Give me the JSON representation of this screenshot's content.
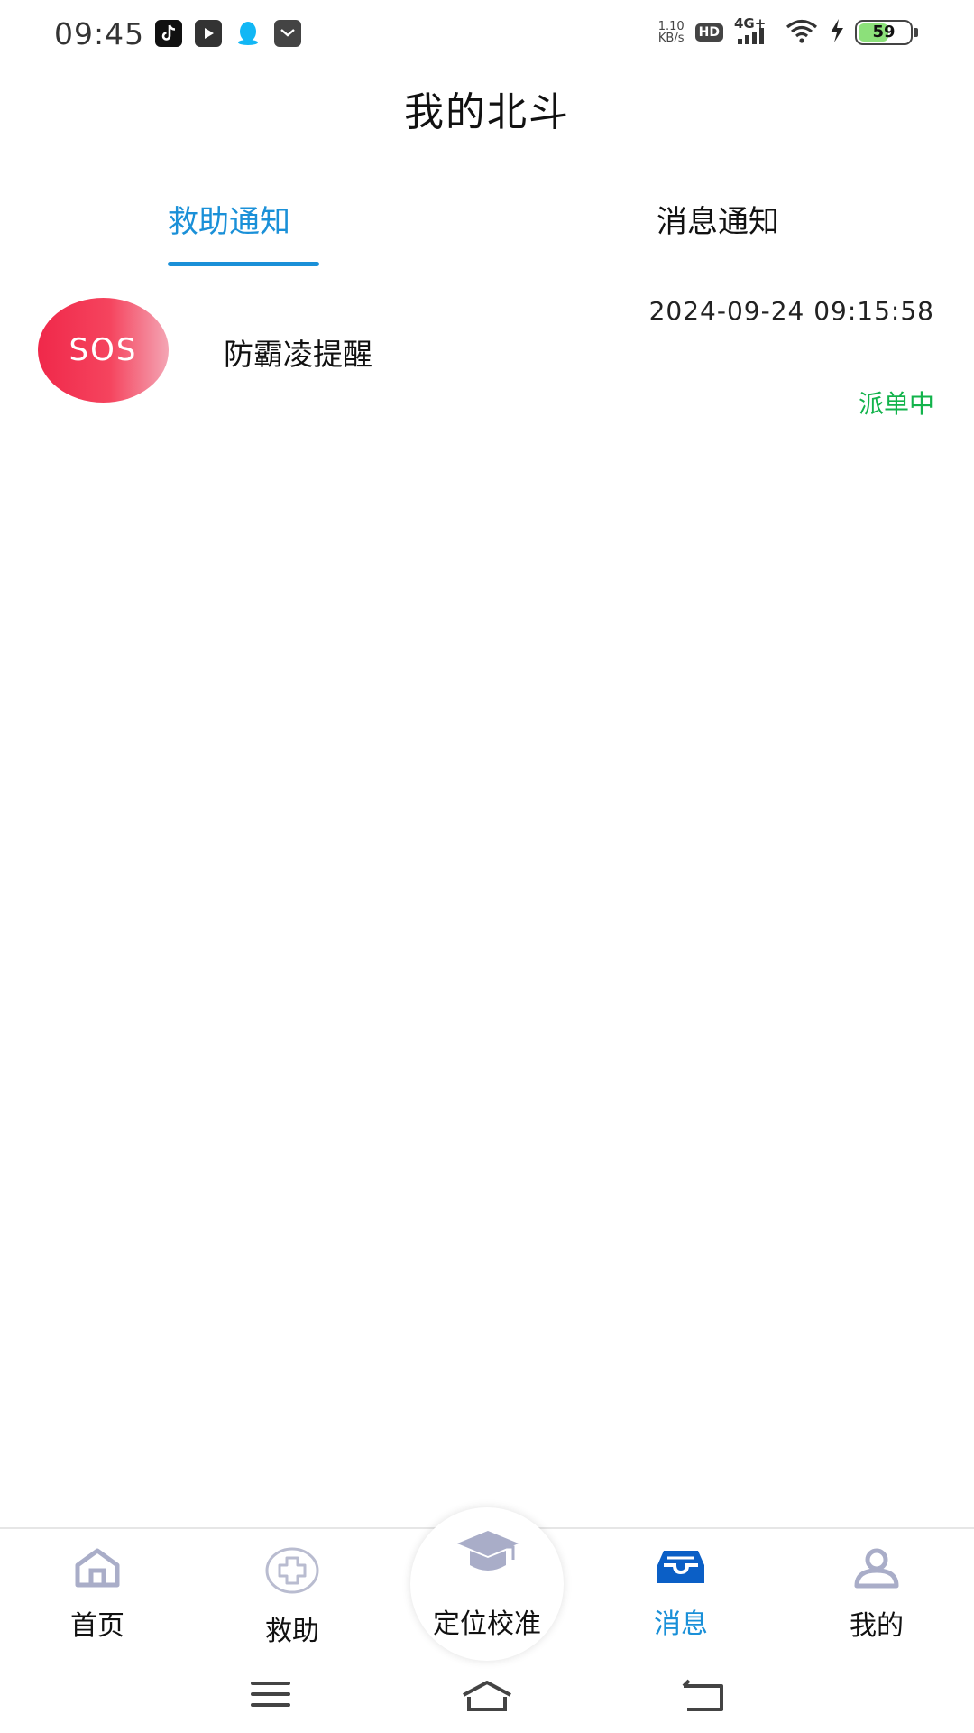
{
  "status_bar": {
    "time": "09:45",
    "net_speed_value": "1.10",
    "net_speed_unit": "KB/s",
    "hd": "HD",
    "network": "4G+",
    "battery": "59",
    "app_icons": [
      "tiktok-icon",
      "video-icon",
      "qq-icon",
      "mail-icon"
    ]
  },
  "header": {
    "title": "我的北斗"
  },
  "tabs": [
    {
      "label": "救助通知",
      "active": true
    },
    {
      "label": "消息通知",
      "active": false
    }
  ],
  "notices": [
    {
      "badge": "SOS",
      "title": "防霸凌提醒",
      "time": "2024-09-24 09:15:58",
      "status": "派单中"
    }
  ],
  "bottom_nav": {
    "items": [
      {
        "label": "首页",
        "icon": "home-icon",
        "active": false
      },
      {
        "label": "救助",
        "icon": "medical-cross-icon",
        "active": false
      },
      {
        "label": "定位校准",
        "icon": "graduation-cap-icon",
        "active": false
      },
      {
        "label": "消息",
        "icon": "inbox-icon",
        "active": true
      },
      {
        "label": "我的",
        "icon": "user-icon",
        "active": false
      }
    ]
  },
  "colors": {
    "accent": "#1a90d8",
    "status_green": "#12b34b",
    "sos_red": "#f0284a",
    "icon_inactive": "#a9adc8"
  }
}
